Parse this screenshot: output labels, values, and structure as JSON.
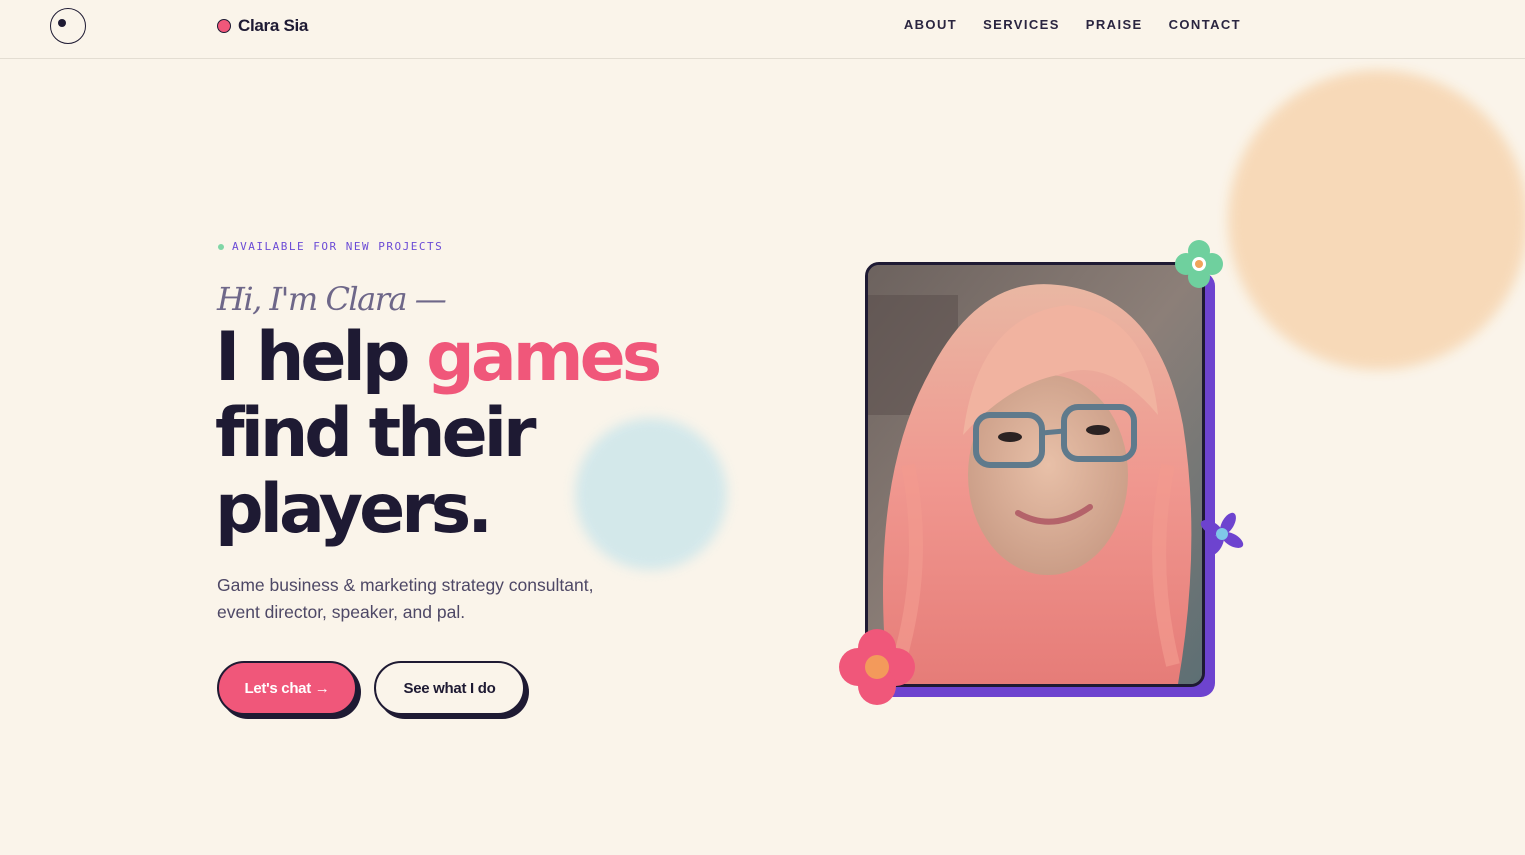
{
  "header": {
    "brand_name": "Clara Sia",
    "nav": [
      "ABOUT",
      "SERVICES",
      "PRAISE",
      "CONTACT"
    ]
  },
  "hero": {
    "availability": "AVAILABLE FOR NEW PROJECTS",
    "greeting": "Hi, I'm Clara —",
    "headline_part1": "I help ",
    "headline_accent": "games",
    "headline_line2": "find their",
    "headline_line3": "players.",
    "subtitle": "Game business & marketing strategy consultant, event director, speaker, and pal.",
    "cta_primary": "Let's chat →",
    "cta_secondary": "See what I do"
  },
  "colors": {
    "background": "#faf4ea",
    "ink": "#1e1a33",
    "accent_pink": "#f0577a",
    "accent_purple": "#6d43cf",
    "peach_blob": "#f7d8b6",
    "blue_blob": "#cfe7eb",
    "status_green": "#7fd6a6"
  },
  "icons": {
    "logo": "cursor-circle-icon",
    "brand": "pink-dot-icon",
    "decor": [
      "green-flower-icon",
      "purple-flower-icon",
      "pink-flower-icon"
    ]
  }
}
